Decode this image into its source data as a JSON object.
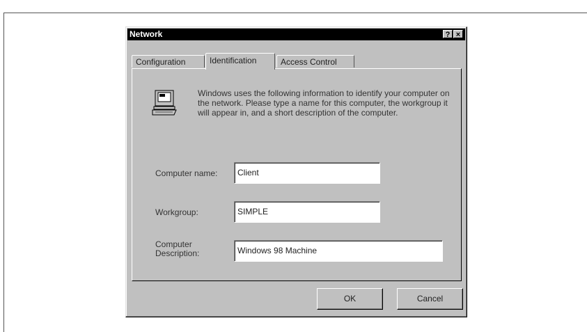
{
  "dialog": {
    "title": "Network",
    "help_button": "?",
    "close_button": "×"
  },
  "tabs": [
    {
      "label": "Configuration",
      "active": false
    },
    {
      "label": "Identification",
      "active": true
    },
    {
      "label": "Access Control",
      "active": false
    }
  ],
  "identification": {
    "icon": "computer-icon",
    "description": "Windows uses the following information to identify your computer on the network. Please type a name for this computer, the workgroup it will appear in, and a short description of the computer.",
    "computer_name_label": "Computer name:",
    "computer_name_value": "Client",
    "workgroup_label": "Workgroup:",
    "workgroup_value": "SIMPLE",
    "description_label_line1": "Computer",
    "description_label_line2": "Description:",
    "description_value": "Windows 98 Machine"
  },
  "buttons": {
    "ok": "OK",
    "cancel": "Cancel"
  }
}
